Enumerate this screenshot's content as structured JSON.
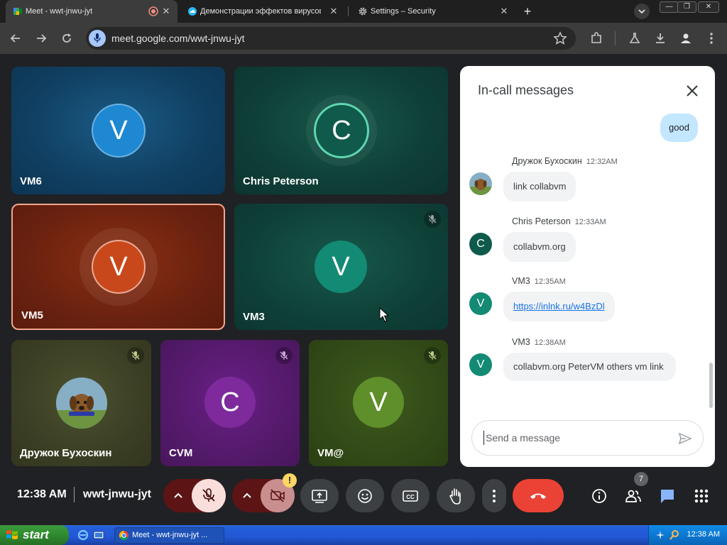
{
  "browser": {
    "tabs": [
      {
        "title": "Meet - wwt-jnwu-jyt",
        "active": true
      },
      {
        "title": "Демонстрации эффектов вирусов",
        "active": false
      },
      {
        "title": "Settings – Security",
        "active": false
      }
    ],
    "url": "meet.google.com/wwt-jnwu-jyt"
  },
  "tiles": [
    {
      "name": "VM6",
      "initial": "V",
      "avatar_color": "#1e88d2"
    },
    {
      "name": "Chris Peterson",
      "initial": "C",
      "avatar_color": "#0f5a4a"
    },
    {
      "name": "VM5",
      "initial": "V",
      "avatar_color": "#c9481b"
    },
    {
      "name": "VM3",
      "initial": "V",
      "avatar_color": "#138a74"
    },
    {
      "name": "Дружок Бухоскин",
      "initial": "",
      "avatar_color": "#6d8a9a"
    },
    {
      "name": "CVM",
      "initial": "C",
      "avatar_color": "#7e2a9c"
    },
    {
      "name": "VM@",
      "initial": "V",
      "avatar_color": "#5f8f2a"
    }
  ],
  "chat": {
    "title": "In-call messages",
    "self_message": "good",
    "messages": [
      {
        "sender": "Дружок Бухоскин",
        "time": "12:32AM",
        "text": "link collabvm",
        "initial": ""
      },
      {
        "sender": "Chris Peterson",
        "time": "12:33AM",
        "text": "collabvm.org",
        "initial": "C"
      },
      {
        "sender": "VM3",
        "time": "12:35AM",
        "text": "https://inlnk.ru/w4BzDl",
        "initial": "V"
      },
      {
        "sender": "VM3",
        "time": "12:38AM",
        "text": "collabvm.org PeterVM others vm link",
        "initial": "V"
      }
    ],
    "placeholder": "Send a message"
  },
  "controls": {
    "time": "12:38 AM",
    "meeting_code": "wwt-jnwu-jyt",
    "camera_warning": "!",
    "people_count": "7"
  },
  "taskbar": {
    "start": "start",
    "task_item": "Meet - wwt-jnwu-jyt ...",
    "clock": "12:38 AM"
  },
  "colors": {
    "end_call": "#ea4335",
    "chat_active": "#8ab4f8",
    "active_speaker_border": "#f4a58b"
  }
}
